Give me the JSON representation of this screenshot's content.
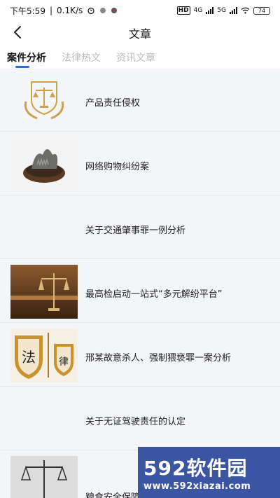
{
  "status_bar": {
    "time": "下午5:59",
    "net_speed": "0.1K/s",
    "hd_label": "HD",
    "net_4g": "4G",
    "net_5g": "5G",
    "battery": "74"
  },
  "header": {
    "title": "文章",
    "back_icon": "chevron-left-icon"
  },
  "tabs": [
    {
      "label": "案件分析",
      "active": true
    },
    {
      "label": "法律热文",
      "active": false
    },
    {
      "label": "资讯文章",
      "active": false
    }
  ],
  "articles": [
    {
      "title": "产品责任侵权",
      "thumbnail": "scales-emblem"
    },
    {
      "title": "网络购物纠纷案",
      "thumbnail": "sea-cucumber-bowl"
    },
    {
      "title": "关于交通肇事罪一例分析",
      "thumbnail": "none"
    },
    {
      "title": "最高检启动一站式“多元解纷平台”",
      "thumbnail": "scales-courtroom"
    },
    {
      "title": "邢某故意杀人、强制猥亵罪一案分析",
      "thumbnail": "law-shields"
    },
    {
      "title": "关于无证驾驶责任的认定",
      "thumbnail": "none"
    },
    {
      "title": "粮食安全保障法草案提请审议",
      "thumbnail": "scales-gray"
    }
  ],
  "watermark": {
    "brand": "592软件园",
    "url": "www.592xiazai.com"
  },
  "colors": {
    "accent": "#2a6fdb",
    "list_background": "#f3f5f8",
    "watermark_bg": "#3c55a2"
  }
}
